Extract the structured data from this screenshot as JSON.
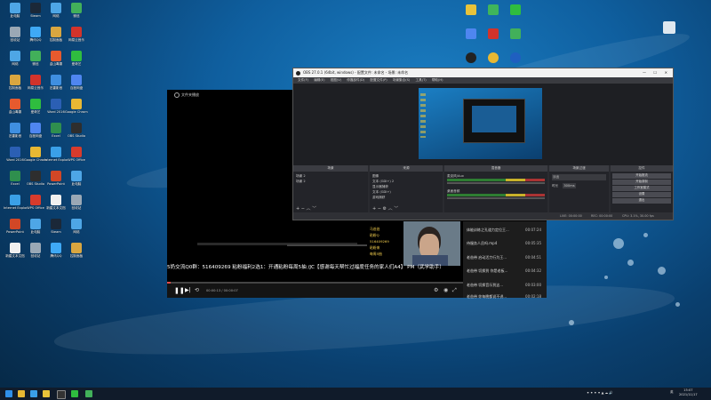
{
  "desktop": {
    "icons": [
      {
        "label": "此电脑",
        "color": "#4ea6e6"
      },
      {
        "label": "回收站",
        "color": "#9aa8b5"
      },
      {
        "label": "网络",
        "color": "#4ea6e6"
      },
      {
        "label": "控制面板",
        "color": "#d9a640"
      },
      {
        "label": "金山毒霸",
        "color": "#e65a2e"
      },
      {
        "label": "迅雷影音",
        "color": "#3f8fe0"
      },
      {
        "label": "Word 2016",
        "color": "#2b5fb4"
      },
      {
        "label": "Excel",
        "color": "#2f8f4e"
      },
      {
        "label": "Internet Explorer",
        "color": "#3aa0e8"
      },
      {
        "label": "PowerPoint",
        "color": "#d24726"
      },
      {
        "label": "新建文本文档",
        "color": "#f0f0f0"
      },
      {
        "label": "Steam",
        "color": "#1b2838"
      },
      {
        "label": "腾讯QQ",
        "color": "#3fa9f5"
      },
      {
        "label": "微信",
        "color": "#42b05a"
      },
      {
        "label": "网易云音乐",
        "color": "#d2332b"
      },
      {
        "label": "爱奇艺",
        "color": "#2fbd3f"
      },
      {
        "label": "百度网盘",
        "color": "#4f86f0"
      },
      {
        "label": "Google Chrome",
        "color": "#e8b833"
      },
      {
        "label": "OBS Studio",
        "color": "#2e2e2e"
      },
      {
        "label": "WPS Office",
        "color": "#d83b2c"
      }
    ]
  },
  "player": {
    "title": "文件夹播放",
    "ticker": "5奶交流Q0群：516409269   粘粉福利2选1：开通粘粉每周5抽 /JC【感谢每天帮忙过福度任务的家人们A4】 PM（武学助手）",
    "time": "00:00:13 / 00:00:07",
    "thumb_text": [
      "马爸爸",
      "粘粉Q",
      "516409269",
      "粘粉来",
      "每周5抽"
    ],
    "playlist": [
      {
        "title": "体能训练之孔道力定位王...",
        "dur": "00:07:24"
      },
      {
        "title": "侍服务人员吗.mp4",
        "dur": "00:05:35"
      },
      {
        "title": "老爸带 启动活力行为王...",
        "dur": "00:04:51"
      },
      {
        "title": "老爸带 切换到 你是老板...",
        "dur": "00:04:32"
      },
      {
        "title": "老爸带 切换音乐到这...",
        "dur": "00:03:00"
      },
      {
        "title": "老爸带 你每晚都说不讲...",
        "dur": "00:02:18"
      }
    ]
  },
  "obs": {
    "title": "OBS 27.0.1 (64bit, windows) - 配置文件: 未命名 - 场景: 未命名",
    "menu": [
      "文件(F)",
      "编辑(E)",
      "视图(V)",
      "停靠部件(D)",
      "配置文件(P)",
      "场景集合(S)",
      "工具(T)",
      "帮助(H)"
    ],
    "docks": {
      "scenes": "场景",
      "sources": "来源",
      "mixer": "混音器",
      "transitions": "场景过渡",
      "controls": "控件"
    },
    "scene_items": [
      "场景 2",
      "场景 2"
    ],
    "source_items": [
      "图像",
      "文本 (GDI+) 2",
      "显示器捕获",
      "文本 (GDI+)",
      "游戏捕获"
    ],
    "mixer": [
      {
        "name": "麦克风/Aux",
        "db": "0.0 dB"
      },
      {
        "name": "桌面音频",
        "db": "0.0 dB"
      }
    ],
    "transition": {
      "type": "淡出",
      "duration_label": "时长",
      "duration": "300ms"
    },
    "controls": [
      "开始推流",
      "开始录制",
      "工作室模式",
      "设置",
      "退出"
    ],
    "status": {
      "live": "LIVE: 00:00:00",
      "rec": "REC: 00:00:00",
      "cpu": "CPU: 3.1%, 30.00 fps"
    }
  },
  "taskbar": {
    "time": "15:07",
    "date": "2021/11/17",
    "lang": "英"
  }
}
